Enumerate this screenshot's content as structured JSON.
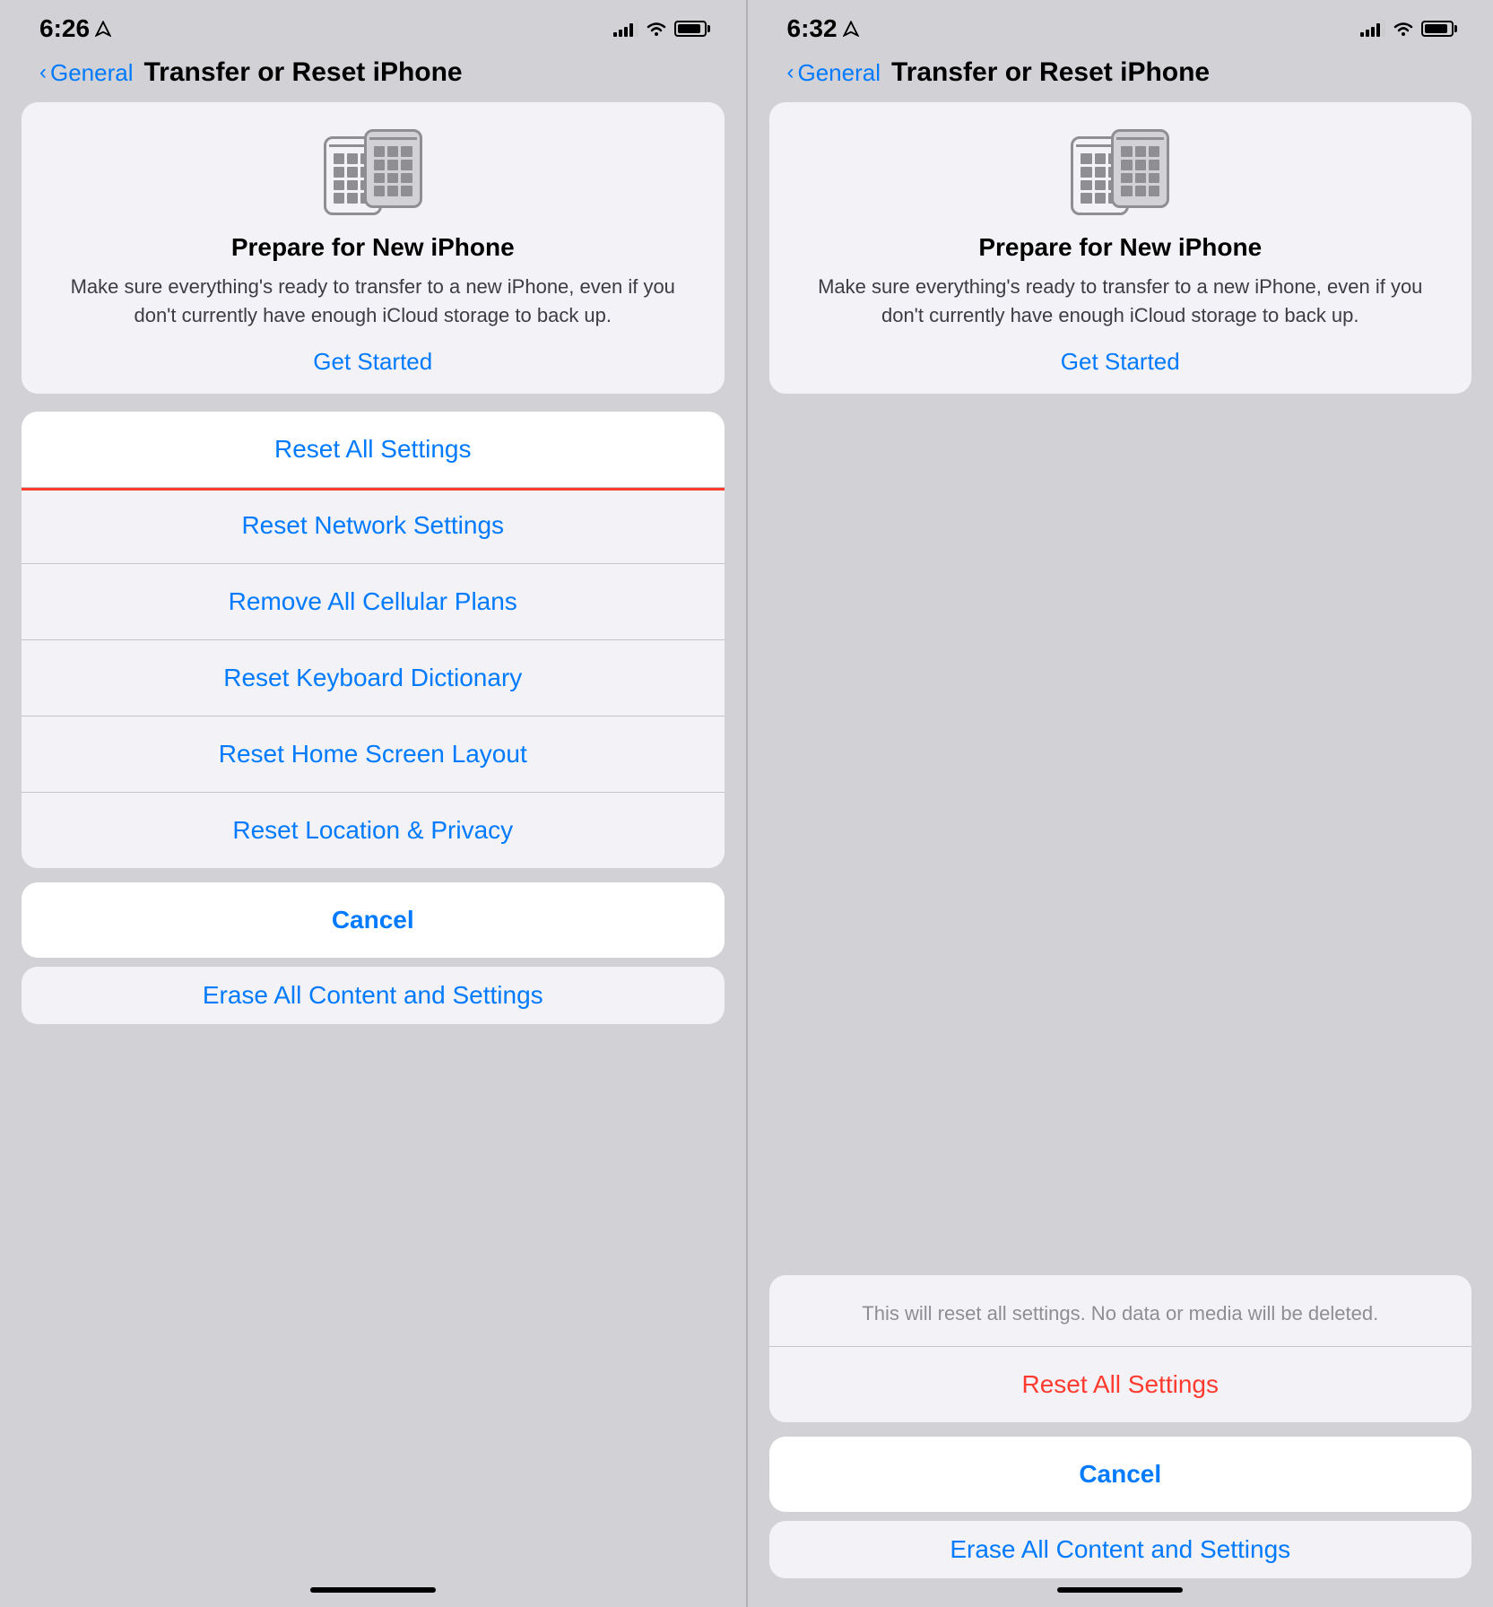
{
  "left": {
    "status": {
      "time": "6:26",
      "location_icon": "⌃"
    },
    "nav": {
      "back_label": "General",
      "title": "Transfer or Reset iPhone"
    },
    "prepare_card": {
      "title": "Prepare for New iPhone",
      "description": "Make sure everything's ready to transfer to a new iPhone, even if you don't currently have enough iCloud storage to back up.",
      "get_started": "Get Started"
    },
    "reset_items": [
      {
        "label": "Reset All Settings",
        "highlighted": true
      },
      {
        "label": "Reset Network Settings",
        "highlighted": false
      },
      {
        "label": "Remove All Cellular Plans",
        "highlighted": false
      },
      {
        "label": "Reset Keyboard Dictionary",
        "highlighted": false
      },
      {
        "label": "Reset Home Screen Layout",
        "highlighted": false
      },
      {
        "label": "Reset Location & Privacy",
        "highlighted": false
      }
    ],
    "cancel": "Cancel",
    "erase_partial": "Erase All Content and Settings"
  },
  "right": {
    "status": {
      "time": "6:32",
      "location_icon": "⌃"
    },
    "nav": {
      "back_label": "General",
      "title": "Transfer or Reset iPhone"
    },
    "prepare_card": {
      "title": "Prepare for New iPhone",
      "description": "Make sure everything's ready to transfer to a new iPhone, even if you don't currently have enough iCloud storage to back up.",
      "get_started": "Get Started"
    },
    "confirmation": {
      "description": "This will reset all settings. No data or media will be deleted.",
      "reset_label": "Reset All Settings"
    },
    "cancel": "Cancel",
    "erase_partial": "Erase All Content and Settings"
  }
}
